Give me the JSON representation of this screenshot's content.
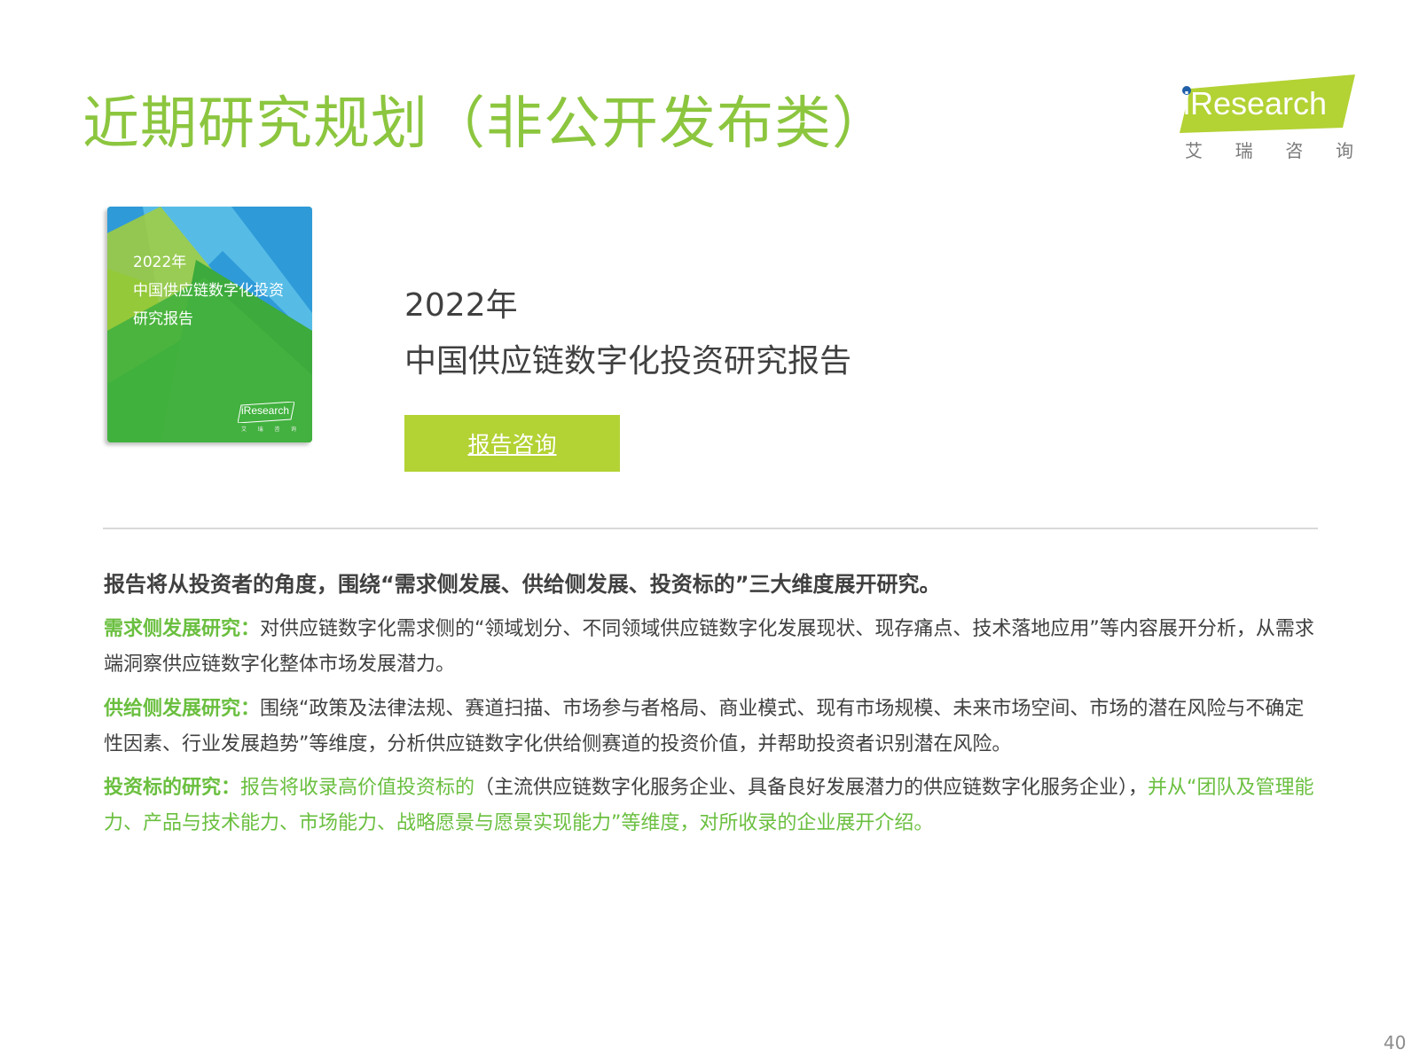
{
  "page_title": "近期研究规划（非公开发布类）",
  "logo": {
    "wordmark": "iResearch",
    "chinese_chars": [
      "艾",
      "瑞",
      "咨",
      "询"
    ],
    "brand_color": "#b3d234"
  },
  "cover": {
    "line1": "2022年",
    "line2": "中国供应链数字化投资",
    "line3": "研究报告",
    "logo_wordmark": "iResearch",
    "logo_chars": [
      "艾",
      "瑞",
      "咨",
      "询"
    ]
  },
  "report": {
    "year": "2022年",
    "name": "中国供应链数字化投资研究报告",
    "button_label": "报告咨询"
  },
  "summary": {
    "lead": "报告将从投资者的角度，围绕“需求侧发展、供给侧发展、投资标的”三大维度展开研究。",
    "sections": [
      {
        "heading": "需求侧发展研究：",
        "body": "对供应链数字化需求侧的“领域划分、不同领域供应链数字化发展现状、现存痛点、技术落地应用”等内容展开分析，从需求端洞察供应链数字化整体市场发展潜力。"
      },
      {
        "heading": "供给侧发展研究：",
        "body": "围绕“政策及法律法规、赛道扫描、市场参与者格局、商业模式、现有市场规模、未来市场空间、市场的潜在风险与不确定性因素、行业发展趋势”等维度，分析供应链数字化供给侧赛道的投资价值，并帮助投资者识别潜在风险。"
      },
      {
        "heading": "投资标的研究：",
        "body_part1": "报告将收录高价值投资标的",
        "body_part2": "（主流供应链数字化服务企业、具备良好发展潜力的供应链数字化服务企业），",
        "body_part3": "并从“团队及管理能力、产品与技术能力、市场能力、战略愿景与愿景实现能力”等维度，对所收录的企业展开介绍。"
      }
    ]
  },
  "page_number": "40",
  "colors": {
    "title_green": "#8cc63f",
    "highlight_green": "#6abf3f",
    "button_lime": "#b3d234",
    "body_text": "#404040"
  }
}
